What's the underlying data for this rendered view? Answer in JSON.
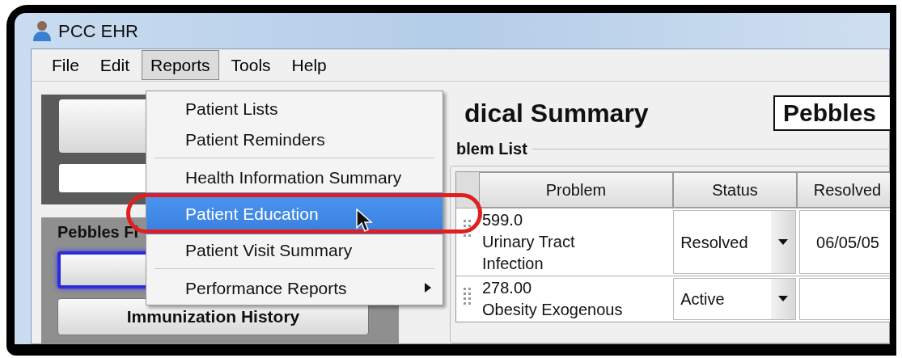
{
  "window": {
    "title": "PCC EHR"
  },
  "menu_bar": [
    {
      "label": "File",
      "selected": false
    },
    {
      "label": "Edit",
      "selected": false
    },
    {
      "label": "Reports",
      "selected": true
    },
    {
      "label": "Tools",
      "selected": false
    },
    {
      "label": "Help",
      "selected": false
    }
  ],
  "reports_menu": [
    {
      "kind": "item",
      "label": "Patient Lists",
      "selected": false
    },
    {
      "kind": "item",
      "label": "Patient Reminders",
      "selected": false
    },
    {
      "kind": "separator"
    },
    {
      "kind": "item",
      "label": "Health Information Summary",
      "selected": false
    },
    {
      "kind": "item",
      "label": "Patient Education",
      "selected": true
    },
    {
      "kind": "item",
      "label": "Patient Visit Summary",
      "selected": false
    },
    {
      "kind": "separator"
    },
    {
      "kind": "submenu",
      "label": "Performance Reports",
      "selected": false
    }
  ],
  "left_panel": {
    "group_title": "Pebbles Fl",
    "buttons": [
      {
        "focused": true
      },
      {
        "label": "Immunization History",
        "focused": false
      }
    ]
  },
  "summary": {
    "heading": "dical Summary",
    "patient": "Pebbles",
    "problem_list": {
      "title": "blem List",
      "columns": [
        "Problem",
        "Status",
        "Resolved"
      ],
      "rows": [
        {
          "code": "599.0",
          "description": "Urinary Tract Infection",
          "status": "Resolved",
          "resolved": "06/05/05"
        },
        {
          "code": "278.00",
          "description": "Obesity Exogenous",
          "status": "Active"
        }
      ]
    }
  }
}
